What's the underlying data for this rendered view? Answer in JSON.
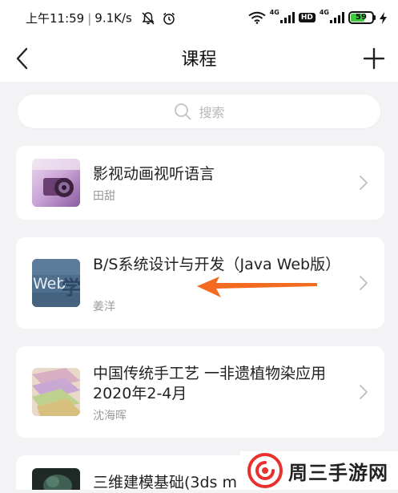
{
  "status_bar": {
    "time": "上午11:59",
    "speed": "9.1K/s",
    "net1": "4G",
    "hd": "HD",
    "net2": "4G",
    "battery": "59",
    "battery_level": 0.59
  },
  "header": {
    "title": "课程"
  },
  "search": {
    "placeholder": "搜索"
  },
  "courses": [
    {
      "title": "影视动画视听语言",
      "teacher": "田甜"
    },
    {
      "title": "B/S系统设计与开发（Java Web版）",
      "teacher": "姜洋"
    },
    {
      "title": "中国传统手工艺 一非遗植物染应用2020年2-4月",
      "teacher": "沈海晖"
    },
    {
      "title": "三维建模基础(3ds m"
    }
  ],
  "thumbs": {
    "web_big": "Web",
    "web_char": "学"
  },
  "watermark": {
    "text": "周三手游网"
  },
  "colors": {
    "accent_arrow": "#f26b21",
    "battery_green": "#3fca3f",
    "watermark_red": "#e8312f"
  }
}
